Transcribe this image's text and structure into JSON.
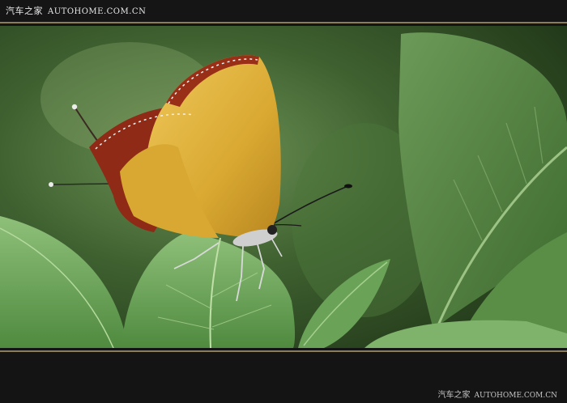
{
  "header": {
    "brand_cn": "汽车之家",
    "brand_site": "AUTOHOME.COM.CN"
  },
  "footer": {
    "watermark_cn": "汽车之家",
    "watermark_site": "AUTOHOME.COM.CN"
  },
  "photo": {
    "subject": "butterfly-on-leaf",
    "colors": {
      "wing_yellow": "#e0b23a",
      "wing_red": "#8e2a16",
      "leaf_green": "#5f9a4e",
      "background_green": "#2e4a22",
      "frame": "#141414",
      "rule": "#8a7d57"
    }
  }
}
